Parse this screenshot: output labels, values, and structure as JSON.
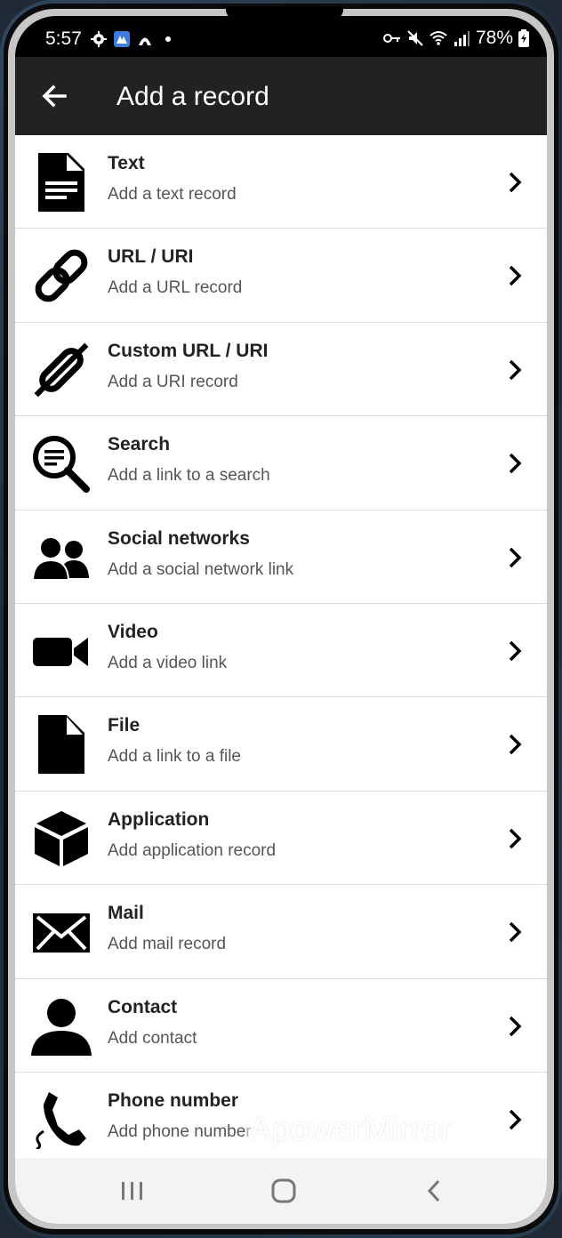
{
  "status_bar": {
    "time": "5:57",
    "battery": "78%"
  },
  "app_bar": {
    "title": "Add a record"
  },
  "records": [
    {
      "title": "Text",
      "subtitle": "Add a text record",
      "icon": "document-icon"
    },
    {
      "title": "URL / URI",
      "subtitle": "Add a URL record",
      "icon": "link-icon"
    },
    {
      "title": "Custom URL / URI",
      "subtitle": "Add a URI record",
      "icon": "custom-link-icon"
    },
    {
      "title": "Search",
      "subtitle": "Add a link to a search",
      "icon": "search-icon"
    },
    {
      "title": "Social networks",
      "subtitle": "Add a social network link",
      "icon": "people-icon"
    },
    {
      "title": "Video",
      "subtitle": "Add a video link",
      "icon": "video-camera-icon"
    },
    {
      "title": "File",
      "subtitle": "Add a link to a file",
      "icon": "file-icon"
    },
    {
      "title": "Application",
      "subtitle": "Add application record",
      "icon": "cube-icon"
    },
    {
      "title": "Mail",
      "subtitle": "Add mail record",
      "icon": "envelope-icon"
    },
    {
      "title": "Contact",
      "subtitle": "Add contact",
      "icon": "person-icon"
    },
    {
      "title": "Phone number",
      "subtitle": "Add phone number",
      "icon": "phone-icon"
    }
  ],
  "watermark": "ApowerMirror",
  "colors": {
    "app_bar": "#222222",
    "list_background": "#ffffff",
    "nav_bar": "#f3f3f3"
  }
}
